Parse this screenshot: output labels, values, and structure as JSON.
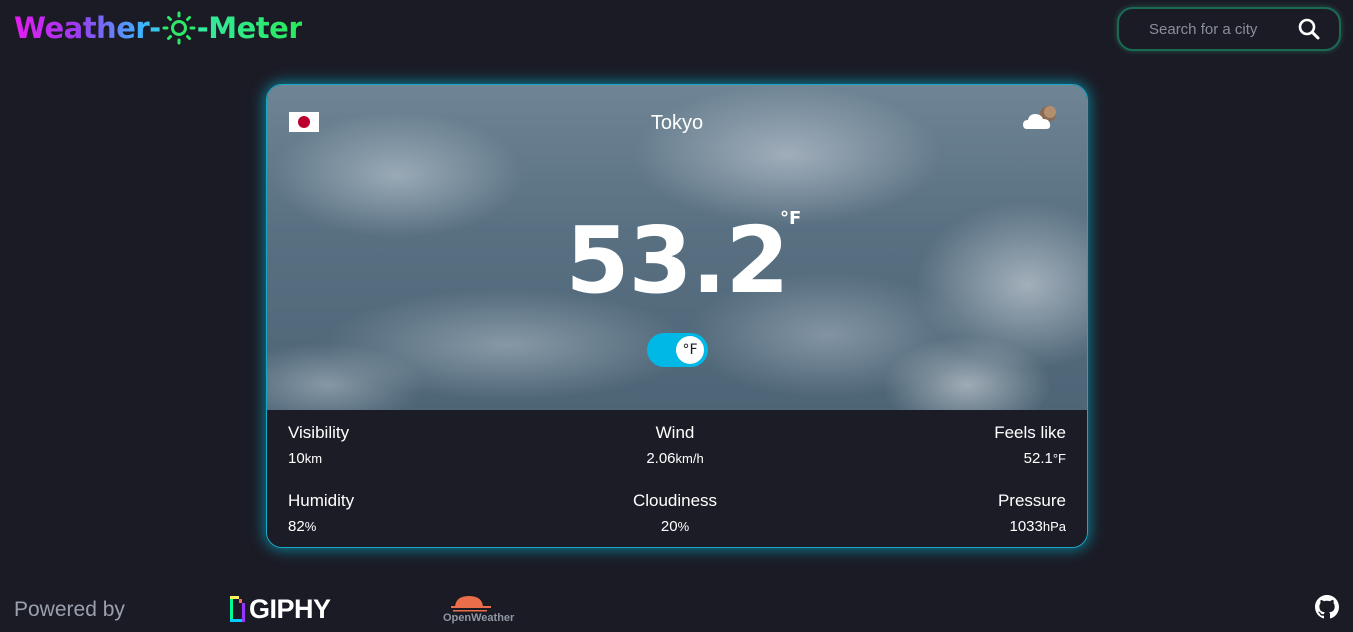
{
  "app": {
    "logo_left": "Weather-",
    "logo_right": "-Meter"
  },
  "search": {
    "placeholder": "Search for a city",
    "value": ""
  },
  "card": {
    "city": "Tokyo",
    "country_flag": "jp-flag",
    "weather_icon": "cloud-with-moon-icon",
    "temperature": "53.2",
    "temperature_unit": "°F",
    "toggle_label": "°F"
  },
  "stats": {
    "visibility": {
      "label": "Visibility",
      "value": "10",
      "unit": "km"
    },
    "wind": {
      "label": "Wind",
      "value": "2.06",
      "unit": "km/h"
    },
    "feels_like": {
      "label": "Feels like",
      "value": "52.1",
      "unit": "°F"
    },
    "humidity": {
      "label": "Humidity",
      "value": "82",
      "unit": "%"
    },
    "cloudiness": {
      "label": "Cloudiness",
      "value": "20",
      "unit": "%"
    },
    "pressure": {
      "label": "Pressure",
      "value": "1033",
      "unit": "hPa"
    }
  },
  "footer": {
    "powered_by": "Powered by",
    "giphy_label": "GIPHY",
    "openweather_label": "OpenWeather"
  },
  "colors": {
    "background": "#1b1b25",
    "accent_cyan": "#00b8e6",
    "search_border": "#1a6a52"
  }
}
